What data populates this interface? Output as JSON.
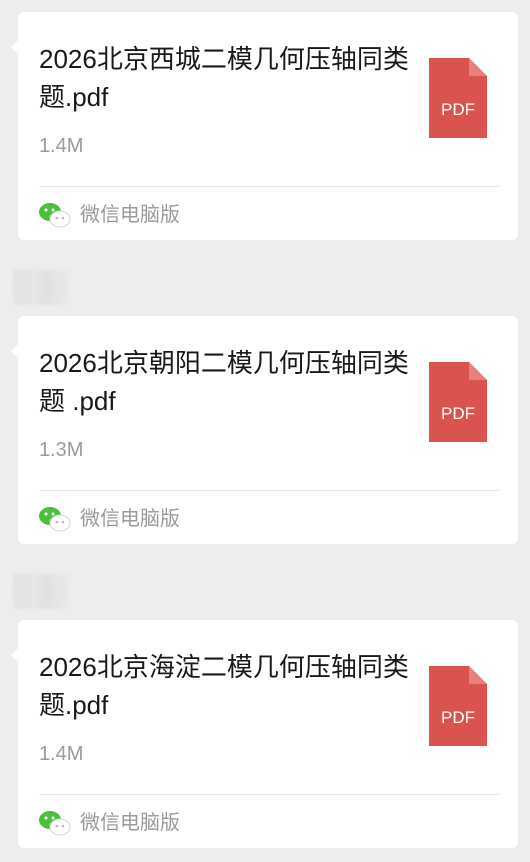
{
  "messages": [
    {
      "file_name": "2026北京西城二模几何压轴同类题.pdf",
      "file_size": "1.4M",
      "file_type": "PDF",
      "source": "微信电脑版"
    },
    {
      "file_name": "2026北京朝阳二模几何压轴同类题 .pdf",
      "file_size": "1.3M",
      "file_type": "PDF",
      "source": "微信电脑版"
    },
    {
      "file_name": "2026北京海淀二模几何压轴同类题.pdf",
      "file_size": "1.4M",
      "file_type": "PDF",
      "source": "微信电脑版"
    }
  ],
  "colors": {
    "background": "#ededed",
    "card": "#ffffff",
    "pdf_red": "#d9534f",
    "wechat_green": "#4cbf3c",
    "muted_text": "#9b9b9b"
  },
  "icons": {
    "file": "pdf-file-icon",
    "source": "wechat-logo-icon"
  }
}
